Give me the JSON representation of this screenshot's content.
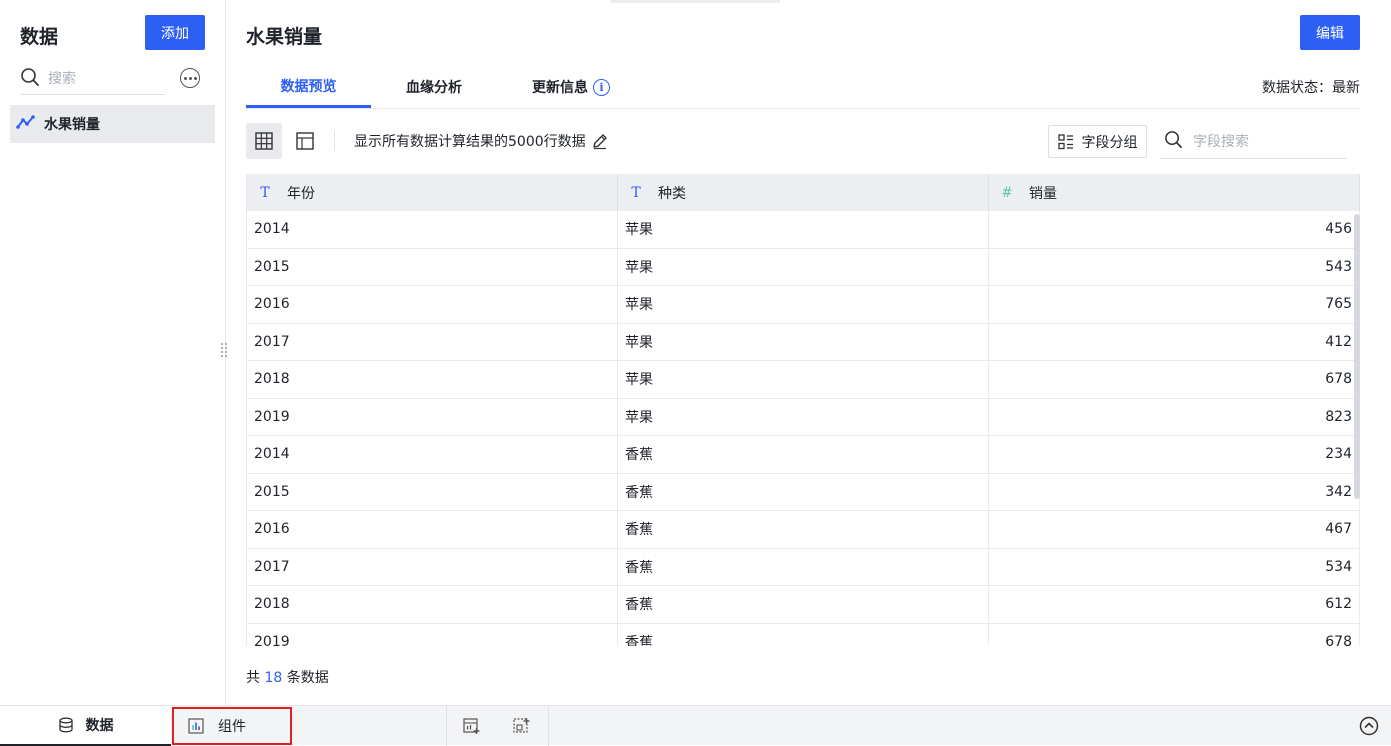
{
  "sidebar": {
    "title": "数据",
    "add_label": "添加",
    "search_placeholder": "搜索",
    "items": [
      {
        "label": "水果销量",
        "icon": "line-chart-icon"
      }
    ]
  },
  "main": {
    "title": "水果销量",
    "edit_label": "编辑",
    "tabs": [
      {
        "label": "数据预览",
        "active": true
      },
      {
        "label": "血缘分析",
        "active": false
      },
      {
        "label": "更新信息",
        "active": false
      }
    ],
    "data_status": "数据状态：最新",
    "toolbar": {
      "description": "显示所有数据计算结果的5000行数据",
      "field_group_label": "字段分组",
      "field_search_placeholder": "字段搜索"
    },
    "table": {
      "columns": [
        {
          "label": "年份",
          "type_icon": "T"
        },
        {
          "label": "种类",
          "type_icon": "T"
        },
        {
          "label": "销量",
          "type_icon": "#"
        }
      ],
      "rows": [
        [
          "2014",
          "苹果",
          "456"
        ],
        [
          "2015",
          "苹果",
          "543"
        ],
        [
          "2016",
          "苹果",
          "765"
        ],
        [
          "2017",
          "苹果",
          "412"
        ],
        [
          "2018",
          "苹果",
          "678"
        ],
        [
          "2019",
          "苹果",
          "823"
        ],
        [
          "2014",
          "香蕉",
          "234"
        ],
        [
          "2015",
          "香蕉",
          "342"
        ],
        [
          "2016",
          "香蕉",
          "467"
        ],
        [
          "2017",
          "香蕉",
          "534"
        ],
        [
          "2018",
          "香蕉",
          "612"
        ],
        [
          "2019",
          "香蕉",
          "678"
        ]
      ]
    },
    "total": {
      "prefix": "共 ",
      "count": "18",
      "suffix": " 条数据"
    }
  },
  "bottom_bar": {
    "data_tab": "数据",
    "component_tab": "组件"
  },
  "colors": {
    "accent": "#2e5ff5",
    "highlight_border": "#e02020",
    "numeric_type": "#5cc8a8"
  }
}
